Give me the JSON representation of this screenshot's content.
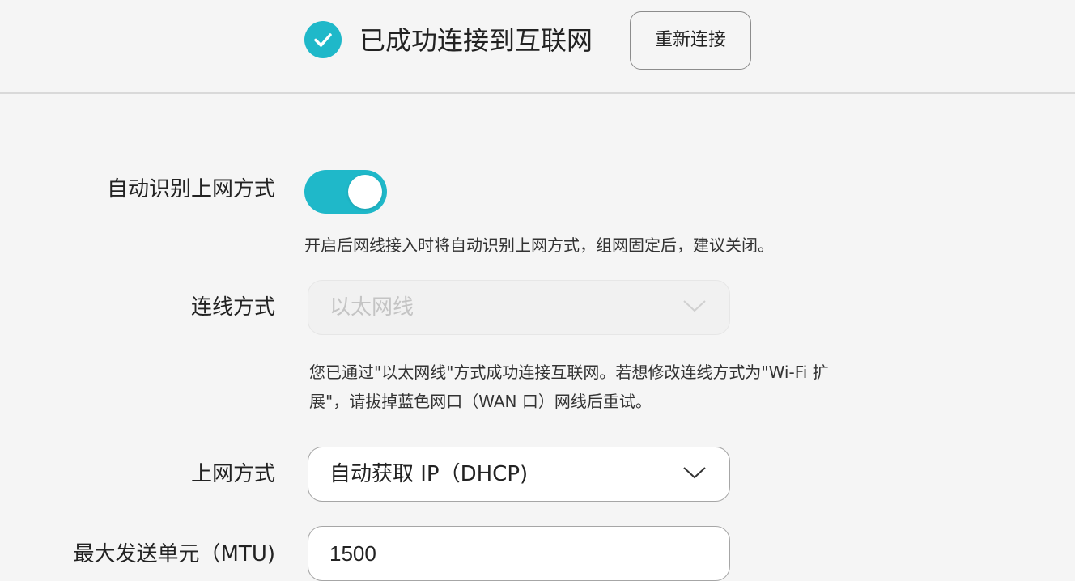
{
  "header": {
    "status_text": "已成功连接到互联网",
    "status_icon": "check-circle-icon",
    "reconnect_label": "重新连接",
    "accent_color": "#1fb8c9"
  },
  "form": {
    "auto_detect": {
      "label": "自动识别上网方式",
      "enabled": true,
      "hint": "开启后网线接入时将自动识别上网方式，组网固定后，建议关闭。"
    },
    "connection_mode": {
      "label": "连线方式",
      "value": "以太网线",
      "disabled": true,
      "hint_line1": "您已通过\"以太网线\"方式成功连接互联网。若想修改连线方式为\"Wi-Fi 扩",
      "hint_line2": "展\"，请拔掉蓝色网口（WAN 口）网线后重试。"
    },
    "internet_mode": {
      "label": "上网方式",
      "value": "自动获取 IP（DHCP)"
    },
    "mtu": {
      "label": "最大发送单元（MTU)",
      "value": "1500"
    }
  }
}
